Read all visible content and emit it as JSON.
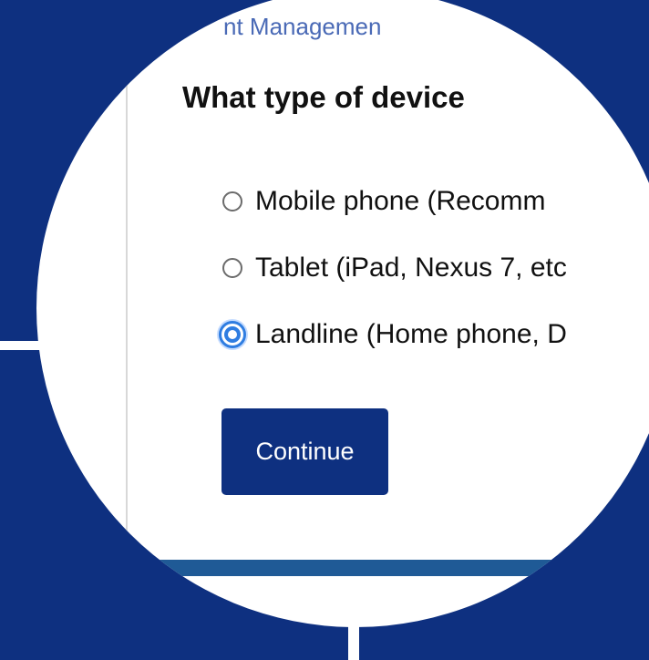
{
  "header": {
    "brand_text": "nt Managemen"
  },
  "question": {
    "title": "What type of device"
  },
  "options": [
    {
      "label": "Mobile phone (Recomm",
      "selected": false
    },
    {
      "label": "Tablet (iPad, Nexus 7, etc",
      "selected": false
    },
    {
      "label": "Landline (Home phone, D",
      "selected": true
    }
  ],
  "actions": {
    "continue_label": "Continue"
  },
  "colors": {
    "background": "#0e3080",
    "button": "#0e3080",
    "selected_radio": "#2f7de1",
    "bottom_band": "#1f5a96"
  }
}
